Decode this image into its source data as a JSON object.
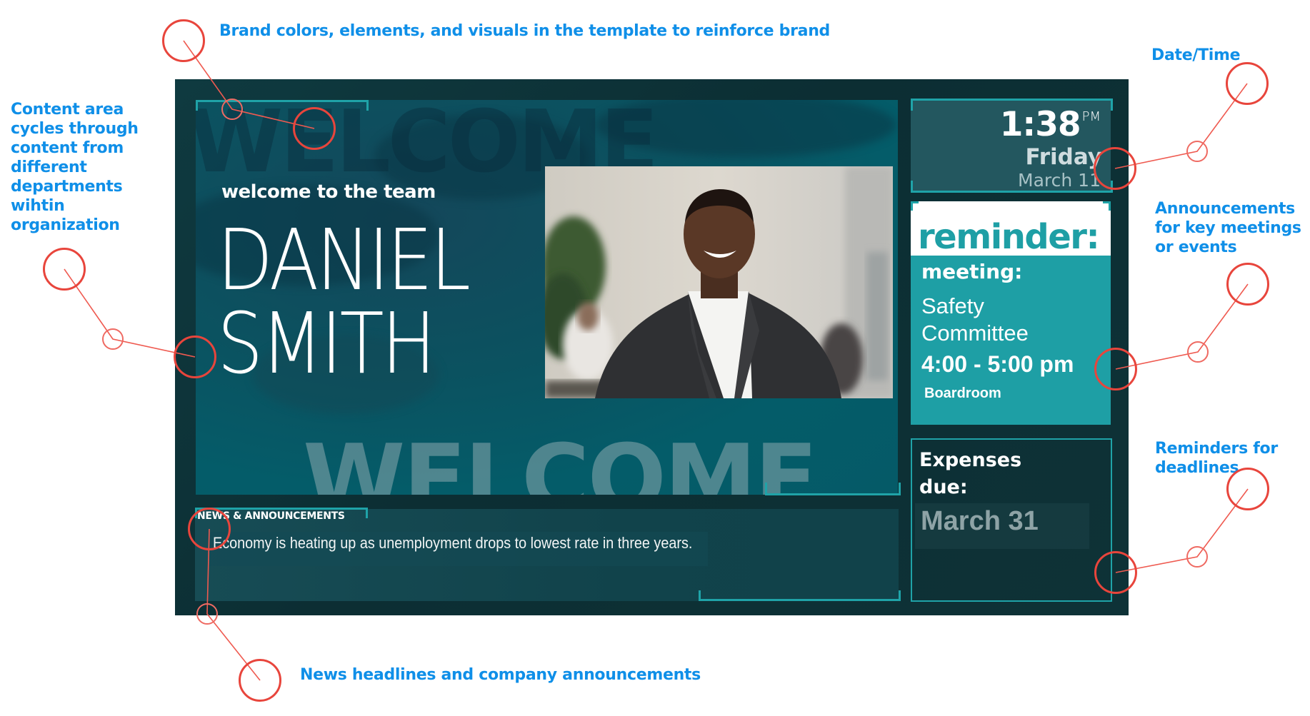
{
  "annotations": {
    "brand": "Brand colors, elements, and visuals in the template to reinforce brand",
    "datetime": "Date/Time",
    "content_area": [
      "Content area",
      "cycles through",
      "content from",
      "different",
      "departments",
      "wihtin",
      "organization"
    ],
    "announcements": [
      "Announcements",
      "for key meetings",
      "or events"
    ],
    "reminders": [
      "Reminders for",
      "deadlines"
    ],
    "news": "News headlines and company announcements"
  },
  "signage": {
    "content": {
      "bg_word": "WELCOME",
      "subtitle": "welcome to the team",
      "first_name": "DANIEL",
      "last_name": "SMITH",
      "photo_alt": "Smiling man in dark blazer in office"
    },
    "clock": {
      "time": "1:38",
      "ampm": "PM",
      "day": "Friday",
      "date": "March 11"
    },
    "reminder": {
      "heading": "reminder:",
      "type": "meeting:",
      "title_line1": "Safety",
      "title_line2": "Committee",
      "time": "4:00 - 5:00 pm",
      "location": "Boardroom"
    },
    "deadline": {
      "line1": "Expenses",
      "line2": "due:",
      "date": "March 31"
    },
    "news": {
      "label": "NEWS & ANNOUNCEMENTS",
      "headline": "Economy is heating up as unemployment drops to lowest rate in three years."
    }
  },
  "colors": {
    "brand_teal": "#1e9fa5",
    "annotation_blue": "#0f8fe8",
    "annotation_red": "#e8453c",
    "panel_dark": "#0e3439"
  }
}
